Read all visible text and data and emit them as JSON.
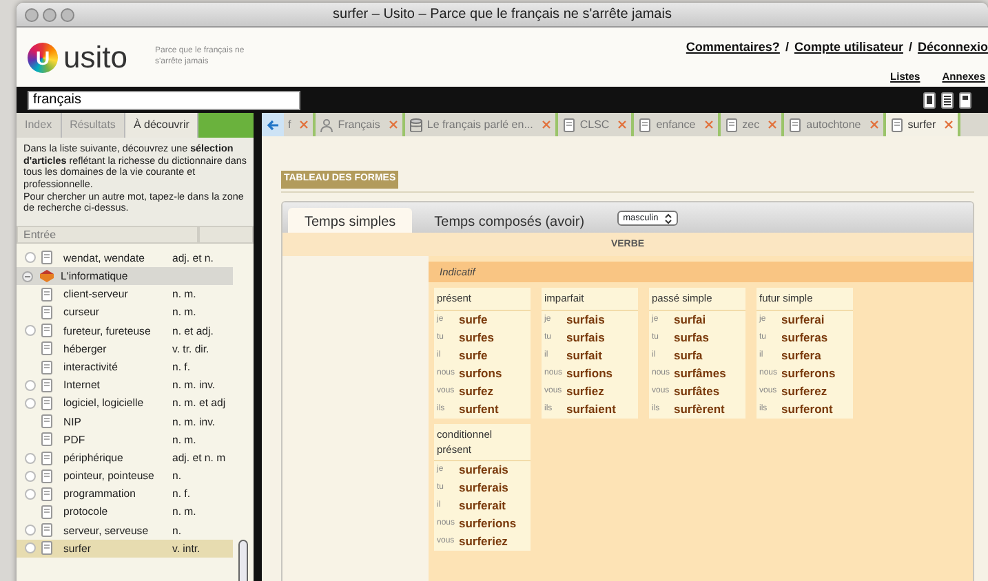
{
  "window": {
    "title": "surfer – Usito – Parce que le français ne s'arrête jamais"
  },
  "header": {
    "logo_letter": "U",
    "logo_text": "usito",
    "tagline": "Parce que le français ne s'arrête jamais",
    "links": [
      {
        "kind": "link",
        "label": "Commentaires?"
      },
      {
        "kind": "separator",
        "label": "/"
      },
      {
        "kind": "link",
        "label": "Compte utilisateur"
      },
      {
        "kind": "separator",
        "label": "/"
      },
      {
        "kind": "link",
        "label": "Déconnexio"
      }
    ],
    "secondary_links": [
      "Listes",
      "Annexes"
    ]
  },
  "search": {
    "value": "français"
  },
  "sidebar": {
    "tabs": [
      {
        "label": "Index",
        "selected": false
      },
      {
        "label": "Résultats",
        "selected": false
      },
      {
        "label": "À découvrir",
        "selected": true
      }
    ],
    "intro": [
      "Dans la liste suivante, découvrez une **sélection d'articles** reflétant la richesse du dictionnaire dans tous les domaines de la vie courante et professionnelle.",
      "Pour chercher un autre mot, tapez-le dans la zone de recherche ci-dessus."
    ],
    "column_header": "Entrée",
    "entries": [
      {
        "kind": "entry",
        "word": "wendat, wendate",
        "pos": "adj. et n.",
        "marked": true,
        "selected": false
      },
      {
        "kind": "group",
        "label": "L'informatique",
        "expanded": true,
        "children": [
          {
            "kind": "entry",
            "word": "client-serveur",
            "pos": "n. m.",
            "marked": false,
            "selected": false
          },
          {
            "kind": "entry",
            "word": "curseur",
            "pos": "n. m.",
            "marked": false,
            "selected": false
          },
          {
            "kind": "entry",
            "word": "fureteur, fureteuse",
            "pos": "n. et adj.",
            "marked": true,
            "selected": false
          },
          {
            "kind": "entry",
            "word": "héberger",
            "pos": "v. tr. dir.",
            "marked": false,
            "selected": false
          },
          {
            "kind": "entry",
            "word": "interactivité",
            "pos": "n. f.",
            "marked": false,
            "selected": false
          },
          {
            "kind": "entry",
            "word": "Internet",
            "pos": "n. m. inv.",
            "marked": true,
            "selected": false
          },
          {
            "kind": "entry",
            "word": "logiciel, logicielle",
            "pos": "n. m. et adj",
            "marked": true,
            "selected": false
          },
          {
            "kind": "entry",
            "word": "NIP",
            "pos": "n. m. inv.",
            "marked": false,
            "selected": false
          },
          {
            "kind": "entry",
            "word": "PDF",
            "pos": "n. m.",
            "marked": false,
            "selected": false
          },
          {
            "kind": "entry",
            "word": "périphérique",
            "pos": "adj. et n. m",
            "marked": true,
            "selected": false
          },
          {
            "kind": "entry",
            "word": "pointeur, pointeuse",
            "pos": "n.",
            "marked": true,
            "selected": false
          },
          {
            "kind": "entry",
            "word": "programmation",
            "pos": "n. f.",
            "marked": true,
            "selected": false
          },
          {
            "kind": "entry",
            "word": "protocole",
            "pos": "n. m.",
            "marked": false,
            "selected": false
          },
          {
            "kind": "entry",
            "word": "serveur, serveuse",
            "pos": "n.",
            "marked": true,
            "selected": false
          },
          {
            "kind": "entry",
            "word": "surfer",
            "pos": "v. intr.",
            "marked": true,
            "selected": true
          }
        ]
      }
    ]
  },
  "doc_tabs": [
    {
      "label": "f",
      "kind": "plain",
      "selected": false
    },
    {
      "label": "Français",
      "kind": "person",
      "selected": false
    },
    {
      "label": "Le français parlé en...",
      "kind": "stack",
      "selected": false
    },
    {
      "label": "CLSC",
      "kind": "document",
      "selected": false
    },
    {
      "label": "enfance",
      "kind": "document",
      "selected": false
    },
    {
      "label": "zec",
      "kind": "document",
      "selected": false
    },
    {
      "label": "autochtone",
      "kind": "document",
      "selected": false
    },
    {
      "label": "surfer",
      "kind": "document",
      "selected": true
    }
  ],
  "content": {
    "section_title": "TABLEAU DES FORMES",
    "form_tabs": [
      {
        "label": "Temps simples",
        "selected": true
      },
      {
        "label": "Temps composés (avoir)",
        "selected": false
      }
    ],
    "gender_select": {
      "value": "masculin"
    },
    "heading": "VERBE",
    "mood": "Indicatif",
    "tense_rows": [
      [
        {
          "name": "présent",
          "forms": [
            [
              "je",
              "surfe"
            ],
            [
              "tu",
              "surfes"
            ],
            [
              "il",
              "surfe"
            ],
            [
              "nous",
              "surfons"
            ],
            [
              "vous",
              "surfez"
            ],
            [
              "ils",
              "surfent"
            ]
          ]
        },
        {
          "name": "imparfait",
          "forms": [
            [
              "je",
              "surfais"
            ],
            [
              "tu",
              "surfais"
            ],
            [
              "il",
              "surfait"
            ],
            [
              "nous",
              "surfions"
            ],
            [
              "vous",
              "surfiez"
            ],
            [
              "ils",
              "surfaient"
            ]
          ]
        },
        {
          "name": "passé simple",
          "forms": [
            [
              "je",
              "surfai"
            ],
            [
              "tu",
              "surfas"
            ],
            [
              "il",
              "surfa"
            ],
            [
              "nous",
              "surfâmes"
            ],
            [
              "vous",
              "surfâtes"
            ],
            [
              "ils",
              "surfèrent"
            ]
          ]
        },
        {
          "name": "futur simple",
          "forms": [
            [
              "je",
              "surferai"
            ],
            [
              "tu",
              "surferas"
            ],
            [
              "il",
              "surfera"
            ],
            [
              "nous",
              "surferons"
            ],
            [
              "vous",
              "surferez"
            ],
            [
              "ils",
              "surferont"
            ]
          ]
        }
      ],
      [
        {
          "name": "conditionnel présent",
          "forms": [
            [
              "je",
              "surferais"
            ],
            [
              "tu",
              "surferais"
            ],
            [
              "il",
              "surferait"
            ],
            [
              "nous",
              "surferions"
            ],
            [
              "vous",
              "surferiez"
            ]
          ]
        }
      ]
    ]
  }
}
